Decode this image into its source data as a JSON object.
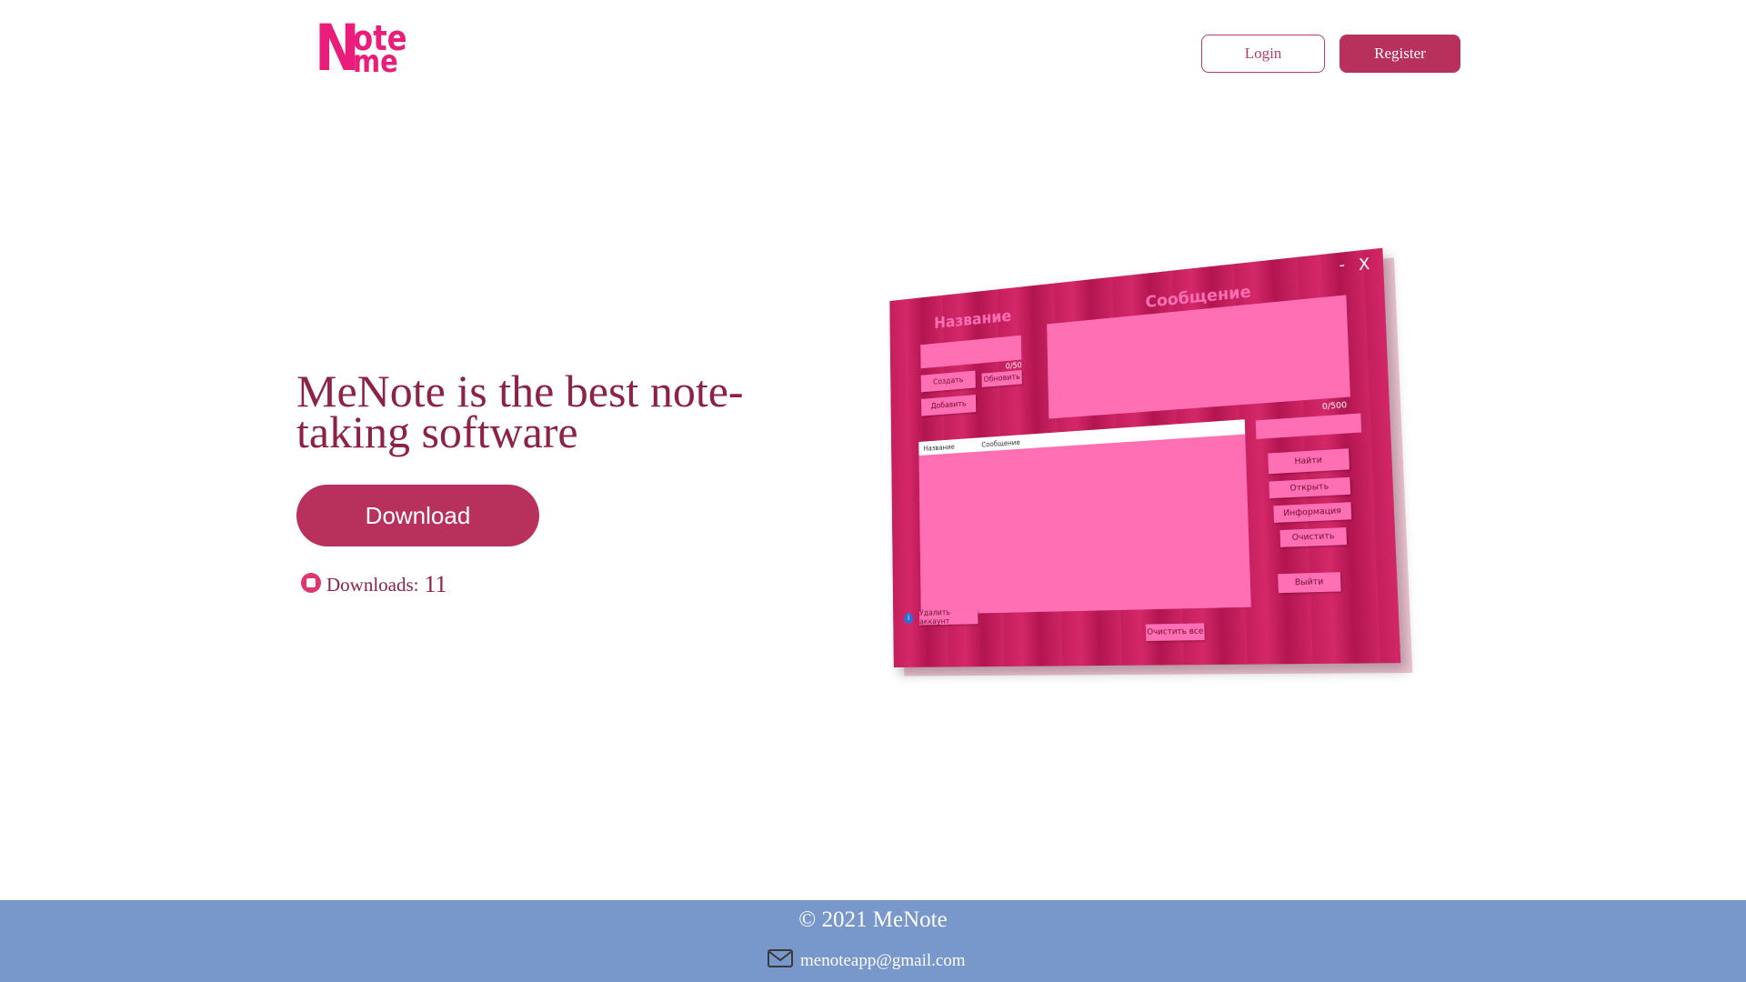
{
  "header": {
    "logo": {
      "big": "N",
      "top": "ote",
      "bottom": "me"
    },
    "login_label": "Login",
    "register_label": "Register"
  },
  "hero": {
    "title_line1": "MeNote is the best note-",
    "title_line2": "taking software",
    "download_label": "Download",
    "downloads_label": "Downloads:",
    "downloads_count": "11"
  },
  "mockup": {
    "title_name": "Название",
    "title_message": "Сообщение",
    "name_counter": "0/50",
    "message_counter": "0/500",
    "buttons": {
      "create": "Создать",
      "update": "Обновить",
      "add": "Добавить",
      "find": "Найти",
      "open": "Открыть",
      "info": "Информация",
      "clear": "Очистить",
      "exit": "Выйти",
      "delete_account": "Удалить аккаунт",
      "clear_all": "Очистить все"
    },
    "list_columns": [
      "Название",
      "Сообщение"
    ],
    "window_min": "-",
    "window_close": "X",
    "info_glyph": "i"
  },
  "footer": {
    "copyright": "© 2021 MeNote",
    "email": "menoteapp@gmail.com"
  },
  "colors": {
    "brand_pink": "#e91e7a",
    "accent": "#b8305c",
    "title_text": "#8c2346",
    "footer_bg": "#7897cb"
  }
}
